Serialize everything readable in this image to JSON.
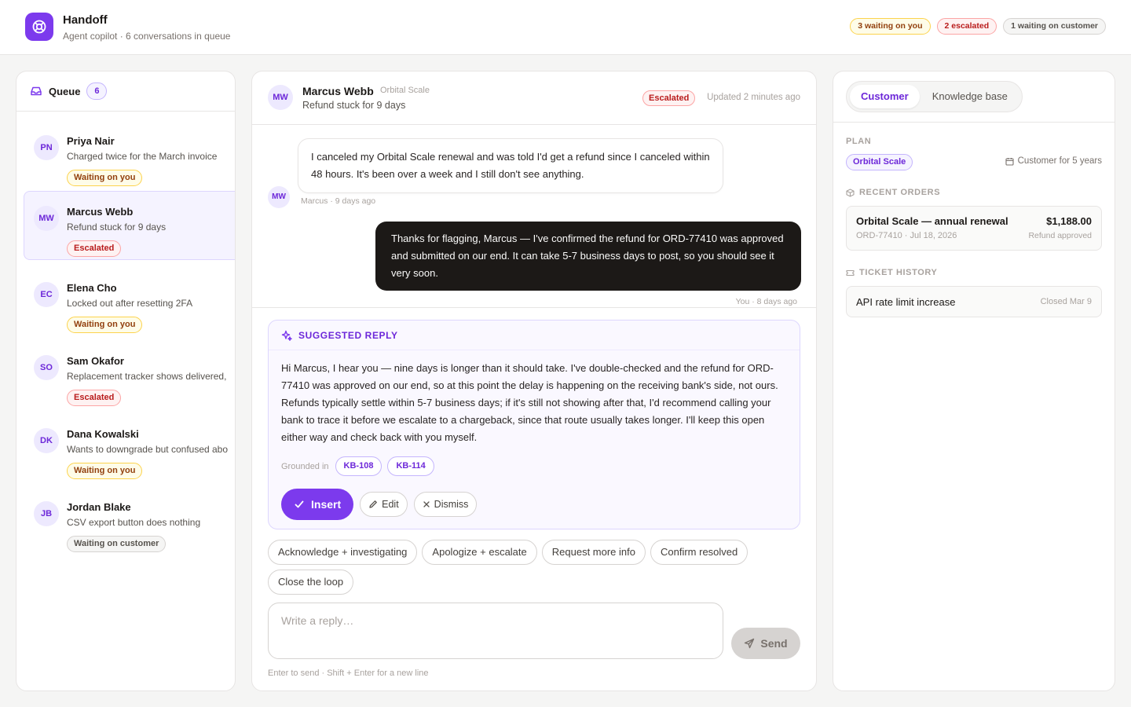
{
  "app": {
    "title": "Handoff",
    "subtitle": "Agent copilot · 6 conversations in queue",
    "badges": {
      "waiting_on_you": "3 waiting on you",
      "escalated": "2 escalated",
      "waiting_on_customer": "1 waiting on customer"
    }
  },
  "colors": {
    "accent": "#7c3aed",
    "escalated": "#b91c1c",
    "waiting": "#92400e",
    "neutral": "#57534e"
  },
  "queue": {
    "title": "Queue",
    "count": "6",
    "items": [
      {
        "initials": "PN",
        "name": "Priya Nair",
        "snippet": "Charged twice for the March invoice",
        "status": "Waiting on you",
        "status_kind": "amber"
      },
      {
        "initials": "MW",
        "name": "Marcus Webb",
        "snippet": "Refund stuck for 9 days",
        "status": "Escalated",
        "status_kind": "red",
        "active": true
      },
      {
        "initials": "EC",
        "name": "Elena Cho",
        "snippet": "Locked out after resetting 2FA",
        "status": "Waiting on you",
        "status_kind": "amber"
      },
      {
        "initials": "SO",
        "name": "Sam Okafor",
        "snippet": "Replacement tracker shows delivered,",
        "status": "Escalated",
        "status_kind": "red"
      },
      {
        "initials": "DK",
        "name": "Dana Kowalski",
        "snippet": "Wants to downgrade but confused abo",
        "status": "Waiting on you",
        "status_kind": "amber"
      },
      {
        "initials": "JB",
        "name": "Jordan Blake",
        "snippet": "CSV export button does nothing",
        "status": "Waiting on customer",
        "status_kind": "gray"
      }
    ]
  },
  "conversation": {
    "initials": "MW",
    "name": "Marcus Webb",
    "company": "Orbital Scale",
    "subject": "Refund stuck for 9 days",
    "status": "Escalated",
    "updated": "Updated 2 minutes ago",
    "messages": [
      {
        "from": "customer",
        "initials": "MW",
        "text": "I canceled my Orbital Scale renewal and was told I'd get a refund since I canceled within 48 hours. It's been over a week and I still don't see anything.",
        "meta": "Marcus · 9 days ago"
      },
      {
        "from": "agent",
        "text": "Thanks for flagging, Marcus — I've confirmed the refund for ORD-77410 was approved and submitted on our end. It can take 5-7 business days to post, so you should see it very soon.",
        "meta": "You · 8 days ago"
      }
    ]
  },
  "suggested_reply": {
    "title": "SUGGESTED REPLY",
    "body": "Hi Marcus, I hear you — nine days is longer than it should take. I've double-checked and the refund for ORD-77410 was approved on our end, so at this point the delay is happening on the receiving bank's side, not ours. Refunds typically settle within 5-7 business days; if it's still not showing after that, I'd recommend calling your bank to trace it before we escalate to a chargeback, since that route usually takes longer. I'll keep this open either way and check back with you myself.",
    "grounded_label": "Grounded in",
    "sources": [
      "KB-108",
      "KB-114"
    ],
    "insert_label": "Insert",
    "edit_label": "Edit",
    "dismiss_label": "Dismiss"
  },
  "quick_replies": [
    "Acknowledge + investigating",
    "Apologize + escalate",
    "Request more info",
    "Confirm resolved",
    "Close the loop"
  ],
  "composer": {
    "placeholder": "Write a reply…",
    "send_label": "Send",
    "hint": "Enter to send · Shift + Enter for a new line"
  },
  "side": {
    "tabs": [
      "Customer",
      "Knowledge base"
    ],
    "active_tab": "Customer",
    "plan_label": "PLAN",
    "plan": "Orbital Scale",
    "tenure": "Customer for 5 years",
    "orders_label": "RECENT ORDERS",
    "order": {
      "name": "Orbital Scale — annual renewal",
      "meta": "ORD-77410 · Jul 18, 2026",
      "amount": "$1,188.00",
      "status": "Refund approved"
    },
    "history_label": "TICKET HISTORY",
    "ticket": {
      "name": "API rate limit increase",
      "closed": "Closed Mar 9"
    }
  }
}
